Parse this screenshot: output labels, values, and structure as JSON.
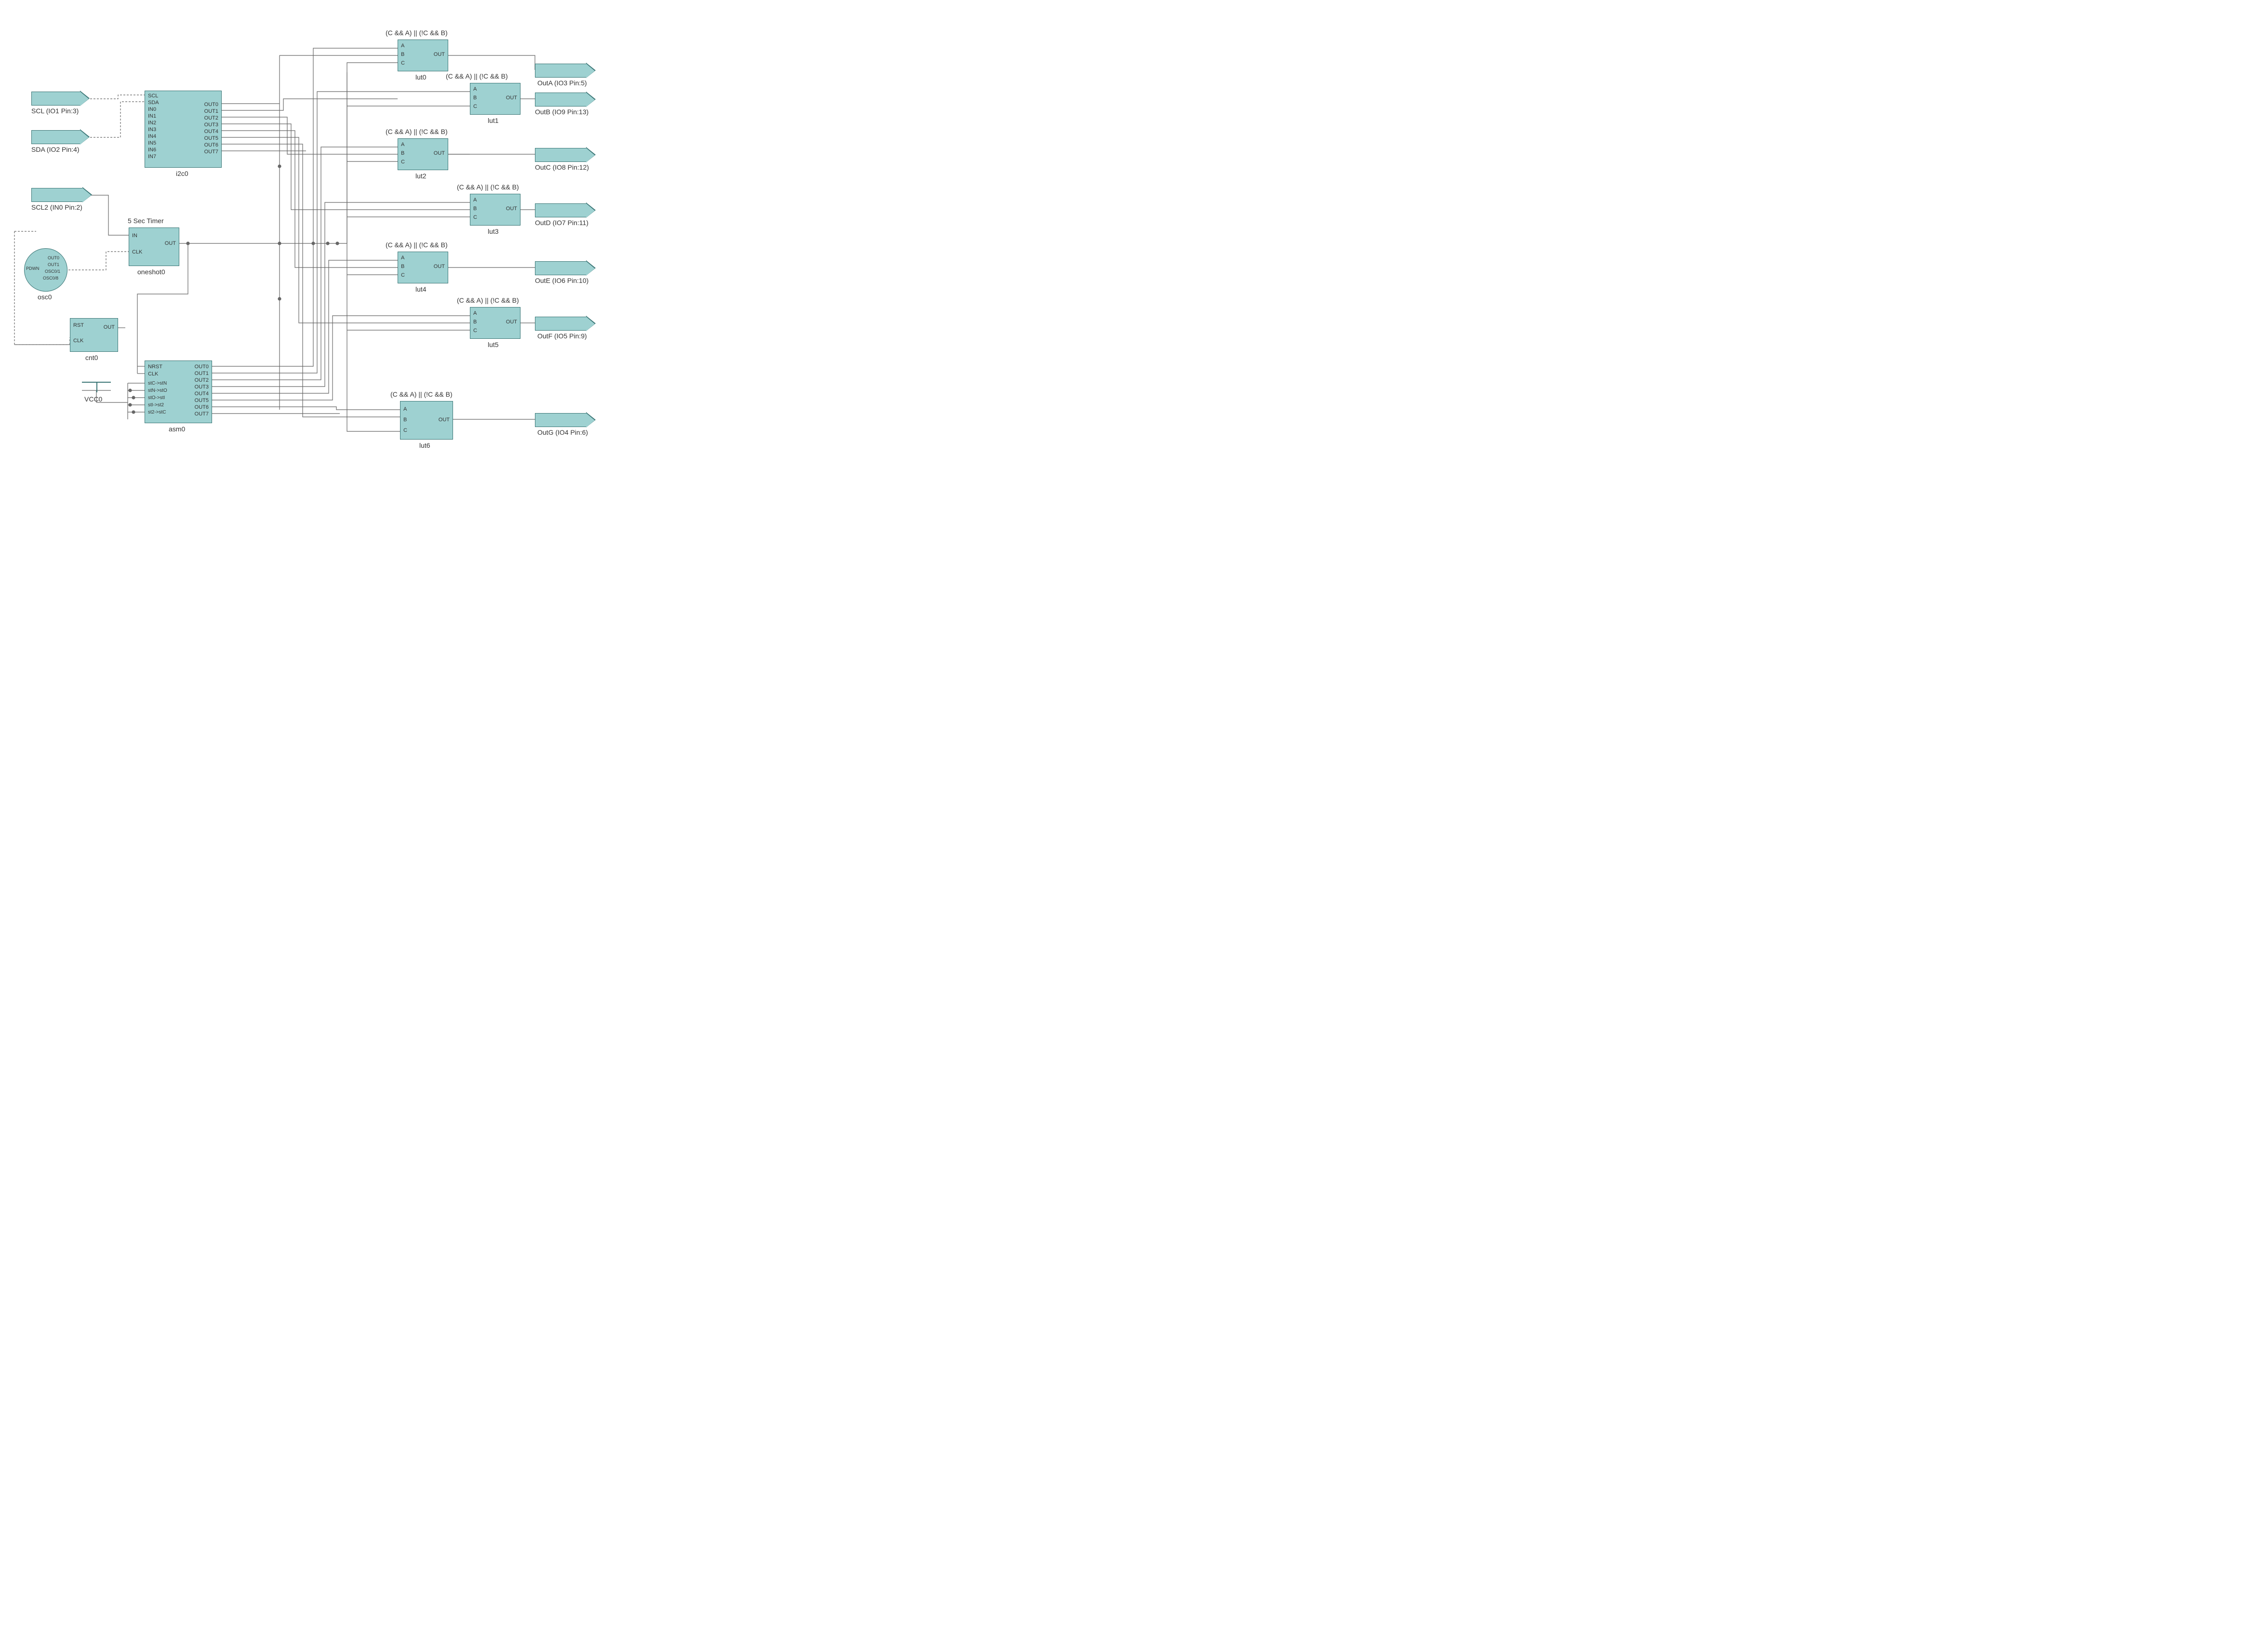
{
  "ports_in": {
    "scl": "SCL (IO1 Pin:3)",
    "sda": "SDA (IO2 Pin:4)",
    "scl2": "SCL2 (IN0 Pin:2)"
  },
  "ports_out": {
    "outa": "OutA (IO3 Pin:5)",
    "outb": "OutB (IO9 Pin:13)",
    "outc": "OutC (IO8 Pin:12)",
    "outd": "OutD (IO7 Pin:11)",
    "oute": "OutE (IO6 Pin:10)",
    "outf": "OutF (IO5 Pin:9)",
    "outg": "OutG (IO4 Pin:6)"
  },
  "i2c": {
    "name": "i2c0",
    "pins_left": [
      "SCL",
      "SDA",
      "IN0",
      "IN1",
      "IN2",
      "IN3",
      "IN4",
      "IN5",
      "IN6",
      "IN7"
    ],
    "pins_right": [
      "OUT0",
      "OUT1",
      "OUT2",
      "OUT3",
      "OUT4",
      "OUT5",
      "OUT6",
      "OUT7"
    ]
  },
  "oneshot": {
    "title": "5 Sec Timer",
    "name": "oneshot0",
    "pins_left": [
      "IN",
      "CLK"
    ],
    "pins_right": [
      "OUT"
    ]
  },
  "osc": {
    "name": "osc0",
    "pins": [
      "PDWN",
      "OUT0",
      "OUT1",
      "OSC0/1",
      "OSC0/8"
    ]
  },
  "cnt": {
    "name": "cnt0",
    "pins_left": [
      "RST",
      "CLK"
    ],
    "pins_right": [
      "OUT"
    ]
  },
  "vcc": "VCC0",
  "asm": {
    "name": "asm0",
    "pins_left": [
      "NRST",
      "CLK",
      "stC->stN",
      "stN->stO",
      "stO->stI",
      "stI->st2",
      "st2->stC"
    ],
    "pins_right": [
      "OUT0",
      "OUT1",
      "OUT2",
      "OUT3",
      "OUT4",
      "OUT5",
      "OUT6",
      "OUT7"
    ]
  },
  "lut": {
    "formula": "(C && A) || (!C && B)",
    "names": [
      "lut0",
      "lut1",
      "lut2",
      "lut3",
      "lut4",
      "lut5",
      "lut6"
    ],
    "pins_left": [
      "A",
      "B",
      "C"
    ],
    "pins_right": [
      "OUT"
    ]
  }
}
